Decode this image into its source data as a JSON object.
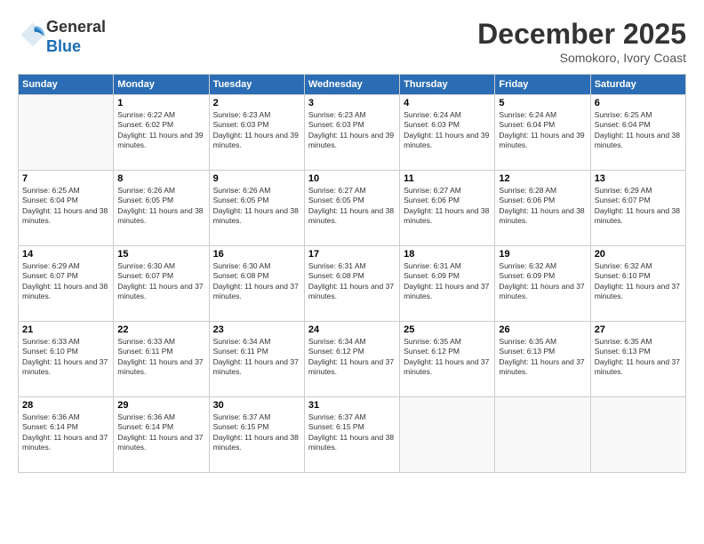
{
  "logo": {
    "general": "General",
    "blue": "Blue"
  },
  "header": {
    "month": "December 2025",
    "location": "Somokoro, Ivory Coast"
  },
  "weekdays": [
    "Sunday",
    "Monday",
    "Tuesday",
    "Wednesday",
    "Thursday",
    "Friday",
    "Saturday"
  ],
  "weeks": [
    [
      {
        "day": "",
        "empty": true
      },
      {
        "day": "1",
        "sunrise": "6:22 AM",
        "sunset": "6:02 PM",
        "daylight": "11 hours and 39 minutes."
      },
      {
        "day": "2",
        "sunrise": "6:23 AM",
        "sunset": "6:03 PM",
        "daylight": "11 hours and 39 minutes."
      },
      {
        "day": "3",
        "sunrise": "6:23 AM",
        "sunset": "6:03 PM",
        "daylight": "11 hours and 39 minutes."
      },
      {
        "day": "4",
        "sunrise": "6:24 AM",
        "sunset": "6:03 PM",
        "daylight": "11 hours and 39 minutes."
      },
      {
        "day": "5",
        "sunrise": "6:24 AM",
        "sunset": "6:04 PM",
        "daylight": "11 hours and 39 minutes."
      },
      {
        "day": "6",
        "sunrise": "6:25 AM",
        "sunset": "6:04 PM",
        "daylight": "11 hours and 38 minutes."
      }
    ],
    [
      {
        "day": "7",
        "sunrise": "6:25 AM",
        "sunset": "6:04 PM",
        "daylight": "11 hours and 38 minutes."
      },
      {
        "day": "8",
        "sunrise": "6:26 AM",
        "sunset": "6:05 PM",
        "daylight": "11 hours and 38 minutes."
      },
      {
        "day": "9",
        "sunrise": "6:26 AM",
        "sunset": "6:05 PM",
        "daylight": "11 hours and 38 minutes."
      },
      {
        "day": "10",
        "sunrise": "6:27 AM",
        "sunset": "6:05 PM",
        "daylight": "11 hours and 38 minutes."
      },
      {
        "day": "11",
        "sunrise": "6:27 AM",
        "sunset": "6:06 PM",
        "daylight": "11 hours and 38 minutes."
      },
      {
        "day": "12",
        "sunrise": "6:28 AM",
        "sunset": "6:06 PM",
        "daylight": "11 hours and 38 minutes."
      },
      {
        "day": "13",
        "sunrise": "6:29 AM",
        "sunset": "6:07 PM",
        "daylight": "11 hours and 38 minutes."
      }
    ],
    [
      {
        "day": "14",
        "sunrise": "6:29 AM",
        "sunset": "6:07 PM",
        "daylight": "11 hours and 38 minutes."
      },
      {
        "day": "15",
        "sunrise": "6:30 AM",
        "sunset": "6:07 PM",
        "daylight": "11 hours and 37 minutes."
      },
      {
        "day": "16",
        "sunrise": "6:30 AM",
        "sunset": "6:08 PM",
        "daylight": "11 hours and 37 minutes."
      },
      {
        "day": "17",
        "sunrise": "6:31 AM",
        "sunset": "6:08 PM",
        "daylight": "11 hours and 37 minutes."
      },
      {
        "day": "18",
        "sunrise": "6:31 AM",
        "sunset": "6:09 PM",
        "daylight": "11 hours and 37 minutes."
      },
      {
        "day": "19",
        "sunrise": "6:32 AM",
        "sunset": "6:09 PM",
        "daylight": "11 hours and 37 minutes."
      },
      {
        "day": "20",
        "sunrise": "6:32 AM",
        "sunset": "6:10 PM",
        "daylight": "11 hours and 37 minutes."
      }
    ],
    [
      {
        "day": "21",
        "sunrise": "6:33 AM",
        "sunset": "6:10 PM",
        "daylight": "11 hours and 37 minutes."
      },
      {
        "day": "22",
        "sunrise": "6:33 AM",
        "sunset": "6:11 PM",
        "daylight": "11 hours and 37 minutes."
      },
      {
        "day": "23",
        "sunrise": "6:34 AM",
        "sunset": "6:11 PM",
        "daylight": "11 hours and 37 minutes."
      },
      {
        "day": "24",
        "sunrise": "6:34 AM",
        "sunset": "6:12 PM",
        "daylight": "11 hours and 37 minutes."
      },
      {
        "day": "25",
        "sunrise": "6:35 AM",
        "sunset": "6:12 PM",
        "daylight": "11 hours and 37 minutes."
      },
      {
        "day": "26",
        "sunrise": "6:35 AM",
        "sunset": "6:13 PM",
        "daylight": "11 hours and 37 minutes."
      },
      {
        "day": "27",
        "sunrise": "6:35 AM",
        "sunset": "6:13 PM",
        "daylight": "11 hours and 37 minutes."
      }
    ],
    [
      {
        "day": "28",
        "sunrise": "6:36 AM",
        "sunset": "6:14 PM",
        "daylight": "11 hours and 37 minutes."
      },
      {
        "day": "29",
        "sunrise": "6:36 AM",
        "sunset": "6:14 PM",
        "daylight": "11 hours and 37 minutes."
      },
      {
        "day": "30",
        "sunrise": "6:37 AM",
        "sunset": "6:15 PM",
        "daylight": "11 hours and 38 minutes."
      },
      {
        "day": "31",
        "sunrise": "6:37 AM",
        "sunset": "6:15 PM",
        "daylight": "11 hours and 38 minutes."
      },
      {
        "day": "",
        "empty": true
      },
      {
        "day": "",
        "empty": true
      },
      {
        "day": "",
        "empty": true
      }
    ]
  ]
}
